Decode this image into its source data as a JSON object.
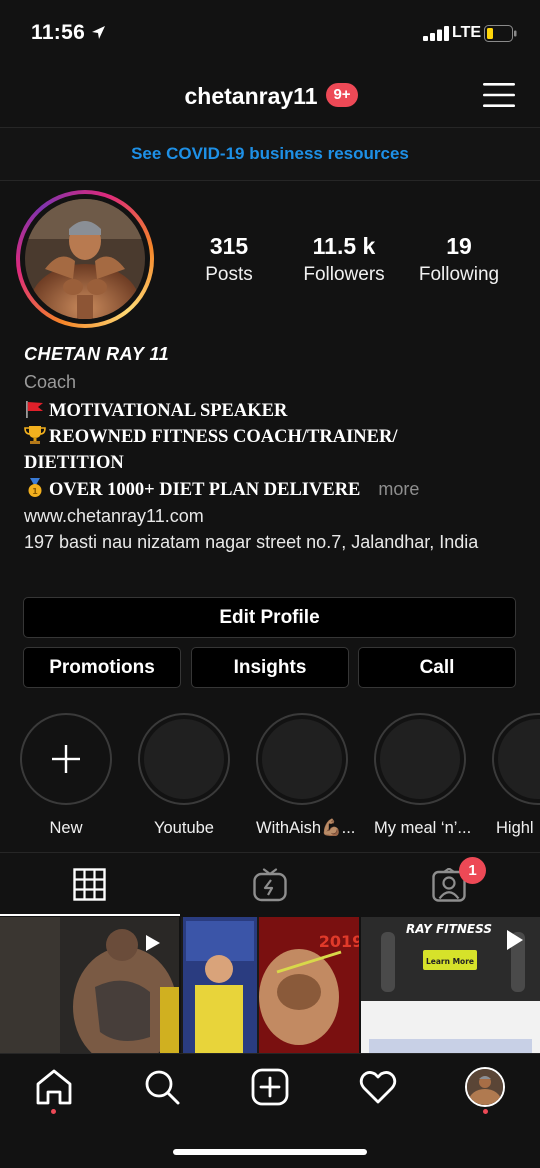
{
  "status_bar": {
    "time": "11:56",
    "network": "LTE"
  },
  "header": {
    "username": "chetanray11",
    "notifications": "9+"
  },
  "banner": {
    "text": "See COVID-19 business resources"
  },
  "stats": [
    {
      "value": "315",
      "label": "Posts"
    },
    {
      "value": "11.5 k",
      "label": "Followers"
    },
    {
      "value": "19",
      "label": "Following"
    }
  ],
  "bio": {
    "name": "CHETAN RAY 11",
    "category": "Coach",
    "line1": "MOTIVATIONAL SPEAKER",
    "line2": "REOWNED FITNESS COACH/TRAINER/",
    "line3": "DIETITION",
    "line4": "OVER 1000+ DIET PLAN DELIVERE",
    "more": "more",
    "website": "www.chetanray11.com",
    "address": "197 basti nau nizatam nagar street no.7, Jalandhar, India"
  },
  "buttons": {
    "edit_profile": "Edit Profile",
    "promotions": "Promotions",
    "insights": "Insights",
    "call": "Call"
  },
  "highlights": [
    {
      "label": "New"
    },
    {
      "label": "Youtube"
    },
    {
      "label": "WithAish💪🏽..."
    },
    {
      "label": "My meal ‘n’..."
    },
    {
      "label": "Highl"
    }
  ],
  "tabs": {
    "tagged_badge": "1"
  },
  "posts": [
    {
      "overlay": ""
    },
    {
      "overlay": "2019"
    },
    {
      "overlay": "RAY FITNESS",
      "cta": "Learn More"
    }
  ],
  "colors": {
    "accent": "#1e90e6",
    "badge": "#ed4956",
    "background": "#121212"
  },
  "icons": [
    "location-arrow-icon",
    "signal-icon",
    "battery-icon",
    "menu-icon",
    "plus-icon",
    "grid-icon",
    "igtv-icon",
    "tagged-icon",
    "home-icon",
    "search-icon",
    "add-post-icon",
    "heart-icon"
  ]
}
